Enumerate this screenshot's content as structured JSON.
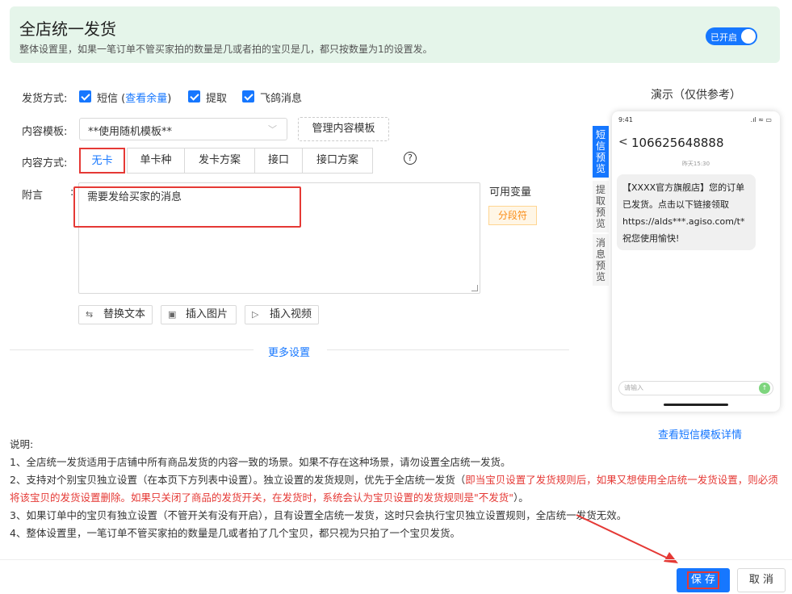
{
  "header": {
    "title": "全店统一发货",
    "subtitle": "整体设置里，如果一笔订单不管买家拍的数量是几或者拍的宝贝是几，都只按数量为1的设置发。",
    "toggle_label": "已开启"
  },
  "delivery": {
    "label": "发货方式:",
    "sms": "短信",
    "balance_open": "(",
    "balance_link": "查看余量",
    "balance_close": ")",
    "pickup": "提取",
    "feige": "飞鸽消息"
  },
  "template": {
    "label": "内容模板:",
    "value": "**使用随机模板**",
    "manage_button": "管理内容模板"
  },
  "content_mode": {
    "label": "内容方式:",
    "options": [
      "无卡",
      "单卡种",
      "发卡方案",
      "接口",
      "接口方案"
    ],
    "selected": "无卡",
    "help": "?"
  },
  "note": {
    "label": "附言",
    "colon": ":",
    "value": "需要发给买家的消息"
  },
  "variables": {
    "title": "可用变量",
    "tag": "分段符"
  },
  "tools": {
    "replace_text": "替换文本",
    "insert_image": "插入图片",
    "insert_video": "插入视频"
  },
  "more_settings": "更多设置",
  "demo": {
    "title": "演示（仅供参考）",
    "time": "9:41",
    "status": ".ıl ≈ ▭",
    "back": "<",
    "number": "106625648888",
    "date": "昨天15:30",
    "message": "【XXXX官方旗舰店】您的订单已发货。点击以下链接领取https://alds***.agiso.com/t*祝您使用愉快!",
    "input_placeholder": "请输入",
    "send": "↑",
    "tabs": [
      "短信预览",
      "提取预览",
      "消息预览"
    ],
    "detail_link": "查看短信模板详情"
  },
  "notes": {
    "title": "说明:",
    "item1": "1、全店统一发货适用于店铺中所有商品发货的内容一致的场景。如果不存在这种场景，请勿设置全店统一发货。",
    "item2_a": "2、支持对个别宝贝独立设置（在本页下方列表中设置）。独立设置的发货规则，优先于全店统一发货（",
    "item2_red": "即当宝贝设置了发货规则后，如果又想使用全店统一发货设置，则必须将该宝贝的发货设置删除。如果只关闭了商品的发货开关，在发货时，系统会认为宝贝设置的发货规则是\"不发货\"",
    "item2_b": "）。",
    "item3": "3、如果订单中的宝贝有独立设置（不管开关有没有开启），且有设置全店统一发货，这时只会执行宝贝独立设置规则，全店统一发货无效。",
    "item4": "4、整体设置里，一笔订单不管买家拍的数量是几或者拍了几个宝贝，都只视为只拍了一个宝贝发货。"
  },
  "footer": {
    "save": "保 存",
    "cancel": "取 消"
  },
  "colors": {
    "primary": "#1677ff",
    "highlight_red": "#e53935",
    "header_bg": "#e5f5ea",
    "tag_orange": "#fa8c16"
  }
}
